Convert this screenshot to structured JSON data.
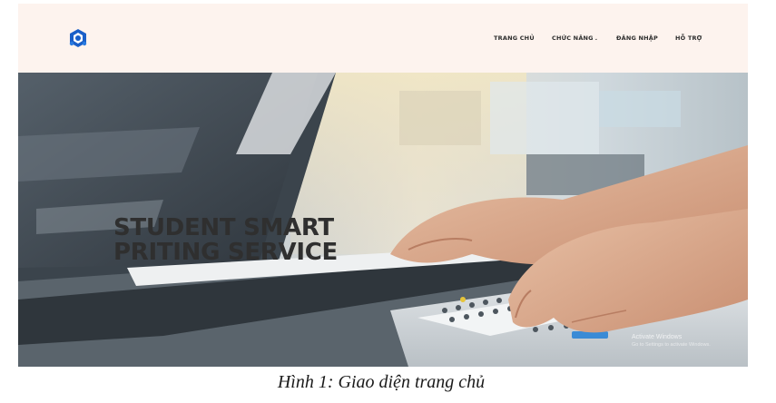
{
  "header": {
    "logo_icon": "university-logo-icon",
    "nav": [
      {
        "label": "TRANG CHỦ"
      },
      {
        "label": "CHỨC NĂNG",
        "has_dropdown": true
      },
      {
        "label": "ĐĂNG NHẬP"
      },
      {
        "label": "HỖ TRỢ"
      }
    ]
  },
  "hero": {
    "title_line1": "STUDENT SMART",
    "title_line2": "PRITING SERVICE",
    "image": "hands-using-photocopier-image"
  },
  "watermark": {
    "line1": "Activate Windows",
    "line2": "Go to Settings to activate Windows."
  },
  "caption": "Hình 1: Giao diện trang chủ",
  "colors": {
    "navbar_bg": "#fdf3ee",
    "logo_blue": "#1a5fc8"
  }
}
